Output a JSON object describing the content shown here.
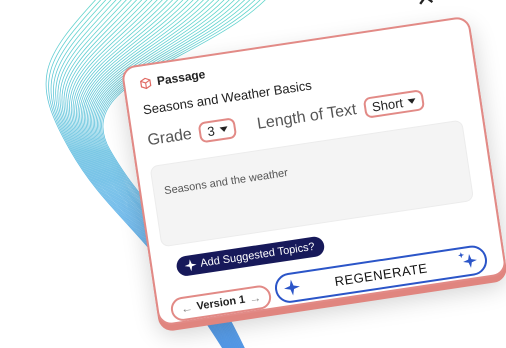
{
  "panel": {
    "heading": "Passage",
    "topic_title": "Seasons and Weather Basics",
    "close_symbol": "✕"
  },
  "controls": {
    "grade_label": "Grade",
    "grade_value": "3",
    "length_label": "Length of Text",
    "length_value": "Short"
  },
  "textarea": {
    "value": "Seasons and the weather"
  },
  "buttons": {
    "suggest_label": "Add Suggested Topics?",
    "version_label": "Version 1",
    "version_prev": "←",
    "version_next": "→",
    "regenerate_label": "REGENERATE"
  },
  "colors": {
    "accent_coral": "#e28a86",
    "navy": "#17195a",
    "blue": "#2b55c8"
  },
  "icons": {
    "heading_icon": "box-icon",
    "close_icon": "close-icon",
    "sparkle_icon": "sparkle-icon"
  }
}
